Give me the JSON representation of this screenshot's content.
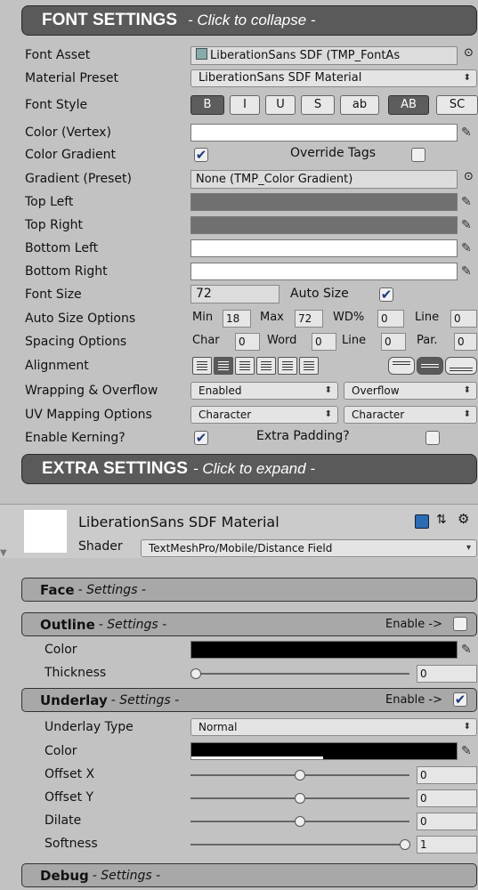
{
  "font_settings": {
    "title": "FONT SETTINGS",
    "subtitle": "- Click to collapse -",
    "font_asset_label": "Font Asset",
    "font_asset_value": "LiberationSans SDF (TMP_FontAs",
    "material_preset_label": "Material Preset",
    "material_preset_value": "LiberationSans SDF Material",
    "font_style_label": "Font Style",
    "style_buttons": [
      "B",
      "I",
      "U",
      "S",
      "ab",
      "AB",
      "SC"
    ],
    "color_vertex_label": "Color (Vertex)",
    "color_gradient_label": "Color Gradient",
    "override_tags_label": "Override Tags",
    "gradient_preset_label": "Gradient (Preset)",
    "gradient_preset_value": "None (TMP_Color Gradient)",
    "top_left_label": "Top Left",
    "top_right_label": "Top Right",
    "bottom_left_label": "Bottom Left",
    "bottom_right_label": "Bottom Right",
    "font_size_label": "Font Size",
    "font_size_value": "72",
    "auto_size_label": "Auto Size",
    "auto_size_options_label": "Auto Size Options",
    "min_label": "Min",
    "min_value": "18",
    "max_label": "Max",
    "max_value": "72",
    "wd_label": "WD%",
    "wd_value": "0",
    "line_label": "Line",
    "line_value": "0",
    "spacing_options_label": "Spacing Options",
    "char_label": "Char",
    "char_value": "0",
    "word_label": "Word",
    "word_value": "0",
    "spacing_line_label": "Line",
    "spacing_line_value": "0",
    "par_label": "Par.",
    "par_value": "0",
    "alignment_label": "Alignment",
    "wrapping_label": "Wrapping & Overflow",
    "wrapping_value": "Enabled",
    "overflow_value": "Overflow",
    "uv_mapping_label": "UV Mapping Options",
    "uv_h_value": "Character",
    "uv_v_value": "Character",
    "kerning_label": "Enable Kerning?",
    "extra_padding_label": "Extra Padding?"
  },
  "extra_settings": {
    "title": "EXTRA SETTINGS",
    "subtitle": "- Click to expand -"
  },
  "material": {
    "name": "LiberationSans SDF Material",
    "shader_label": "Shader",
    "shader_value": "TextMeshPro/Mobile/Distance Field"
  },
  "face": {
    "title": "Face",
    "subtitle": "- Settings -"
  },
  "outline": {
    "title": "Outline",
    "subtitle": "- Settings -",
    "enable_label": "Enable ->",
    "color_label": "Color",
    "thickness_label": "Thickness",
    "thickness_value": "0",
    "thickness_level": 0
  },
  "underlay": {
    "title": "Underlay",
    "subtitle": "- Settings -",
    "enable_label": "Enable ->",
    "type_label": "Underlay Type",
    "type_value": "Normal",
    "color_label": "Color",
    "offset_x_label": "Offset X",
    "offset_x_value": "0",
    "offset_y_label": "Offset Y",
    "offset_y_value": "0",
    "dilate_label": "Dilate",
    "dilate_value": "0",
    "softness_label": "Softness",
    "softness_value": "1"
  },
  "debug": {
    "title": "Debug",
    "subtitle": "- Settings -"
  },
  "icons": {
    "check": "✔",
    "picker": "✎",
    "dropdown_arrow": "⬍",
    "target": "⊙"
  },
  "colors": {
    "header_bg": "#5a5a5a",
    "panel_bg": "#c2c2c2",
    "gradient_gray": "#707070",
    "black": "#000000",
    "white": "#ffffff"
  }
}
